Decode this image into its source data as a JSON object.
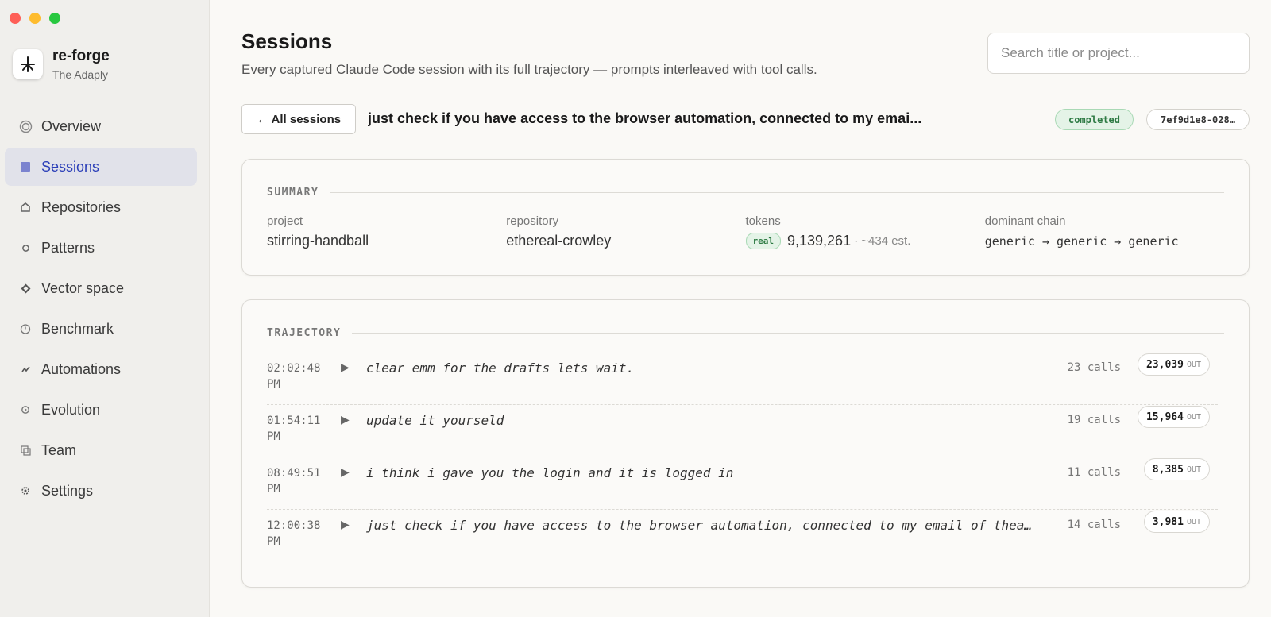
{
  "app": {
    "name": "re-forge",
    "org": "The Adaply"
  },
  "sidebar": {
    "items": [
      {
        "label": "Overview",
        "icon": "circle-target-icon"
      },
      {
        "label": "Sessions",
        "icon": "list-square-icon",
        "active": true
      },
      {
        "label": "Repositories",
        "icon": "home-icon"
      },
      {
        "label": "Patterns",
        "icon": "pattern-dot-icon"
      },
      {
        "label": "Vector space",
        "icon": "diamond-icon"
      },
      {
        "label": "Benchmark",
        "icon": "stopwatch-icon"
      },
      {
        "label": "Automations",
        "icon": "lightning-icon"
      },
      {
        "label": "Evolution",
        "icon": "evolution-icon"
      },
      {
        "label": "Team",
        "icon": "team-icon"
      },
      {
        "label": "Settings",
        "icon": "gear-icon"
      }
    ]
  },
  "header": {
    "title": "Sessions",
    "description": "Every captured Claude Code session with its full trajectory — prompts interleaved with tool calls.",
    "search_placeholder": "Search title or project..."
  },
  "session": {
    "back_label": "← All sessions",
    "title": "just check if you have access to the browser automation, connected to my emai...",
    "status": "completed",
    "id": "7ef9d1e8-028…"
  },
  "summary": {
    "section_label": "SUMMARY",
    "project_label": "project",
    "project_value": "stirring-handball",
    "repository_label": "repository",
    "repository_value": "ethereal-crowley",
    "tokens_label": "tokens",
    "tokens_badge": "real",
    "tokens_value": "9,139,261",
    "tokens_est": "· ~434 est.",
    "chain_label": "dominant chain",
    "chain_value": "generic → generic → generic"
  },
  "trajectory": {
    "section_label": "TRAJECTORY",
    "out_unit": "OUT",
    "rows": [
      {
        "time": "02:02:48",
        "ampm": "PM",
        "prompt": "clear emm for the drafts lets wait.",
        "calls": "23 calls",
        "out": "23,039"
      },
      {
        "time": "01:54:11",
        "ampm": "PM",
        "prompt": "update it yourseld",
        "calls": "19 calls",
        "out": "15,964"
      },
      {
        "time": "08:49:51",
        "ampm": "PM",
        "prompt": "i think i gave you the login and it is logged in",
        "calls": "11 calls",
        "out": "8,385"
      },
      {
        "time": "12:00:38",
        "ampm": "PM",
        "prompt": "just check if you have access to the browser automation, connected to my email of thead…",
        "calls": "14 calls",
        "out": "3,981"
      }
    ]
  },
  "colors": {
    "accent": "#2b3fb8",
    "status_green": "#2d7a43",
    "status_green_bg": "#e4f3e7"
  }
}
